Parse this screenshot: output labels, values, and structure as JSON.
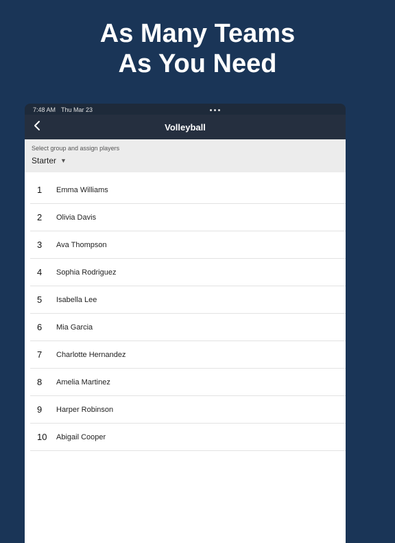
{
  "hero": {
    "line1": "As Many Teams",
    "line2": "As You Need"
  },
  "status": {
    "time": "7:48 AM",
    "date": "Thu Mar 23"
  },
  "nav": {
    "title": "Volleyball"
  },
  "group": {
    "hint": "Select group and assign players",
    "selected": "Starter"
  },
  "players": [
    {
      "num": "1",
      "name": "Emma Williams"
    },
    {
      "num": "2",
      "name": "Olivia Davis"
    },
    {
      "num": "3",
      "name": "Ava Thompson"
    },
    {
      "num": "4",
      "name": "Sophia Rodriguez"
    },
    {
      "num": "5",
      "name": "Isabella Lee"
    },
    {
      "num": "6",
      "name": "Mia Garcia"
    },
    {
      "num": "7",
      "name": "Charlotte Hernandez"
    },
    {
      "num": "8",
      "name": "Amelia Martinez"
    },
    {
      "num": "9",
      "name": "Harper Robinson"
    },
    {
      "num": "10",
      "name": "Abigail Cooper"
    }
  ]
}
